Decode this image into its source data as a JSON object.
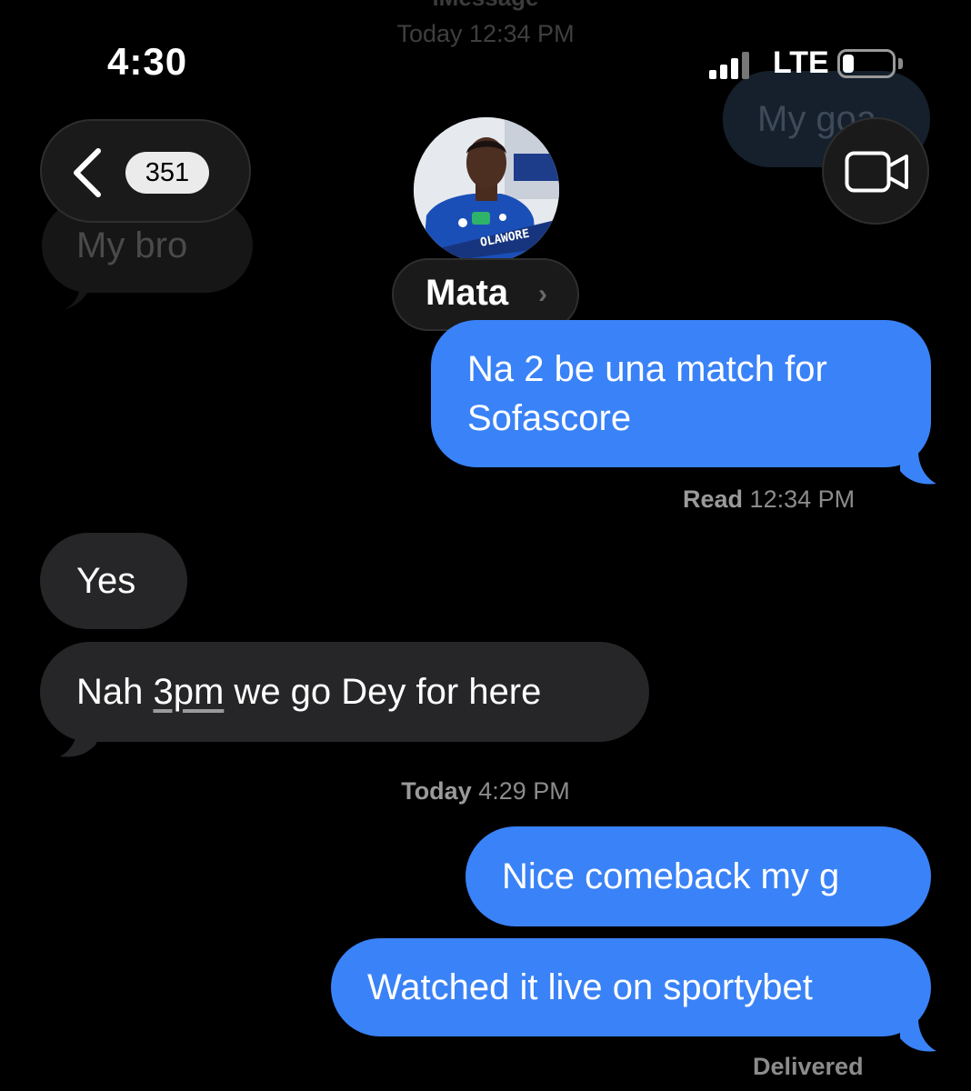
{
  "background_ghosts": {
    "service": "iMessage",
    "time": "Today 12:34 PM",
    "right_bubble": "My goa",
    "left_bubble": "My bro"
  },
  "status_bar": {
    "time": "4:30",
    "network": "LTE",
    "signal_icon": "signal-bars-icon",
    "battery_icon": "battery-low-icon"
  },
  "nav": {
    "back_count": "351",
    "contact_name": "Mata",
    "name_chevron": "›",
    "video_icon": "video-camera-icon",
    "avatar_jersey_text": "OLAWORE"
  },
  "messages": [
    {
      "side": "out",
      "lines": [
        "Na 2 be una match for",
        "Sofascore"
      ]
    },
    {
      "side": "in",
      "text": "Yes"
    },
    {
      "side": "in",
      "text_before": "Nah ",
      "link": "3pm",
      "text_after": " we go Dey for here"
    },
    {
      "side": "out",
      "text": "Nice comeback my g"
    },
    {
      "side": "out",
      "text": "Watched it live on sportybet"
    }
  ],
  "receipt": {
    "status": "Read",
    "time": "12:34 PM"
  },
  "timestamp2": {
    "day": "Today",
    "time": "4:29 PM"
  },
  "delivered": "Delivered",
  "colors": {
    "outgoing": "#3a82f7",
    "incoming": "#262628",
    "background": "#000000"
  }
}
